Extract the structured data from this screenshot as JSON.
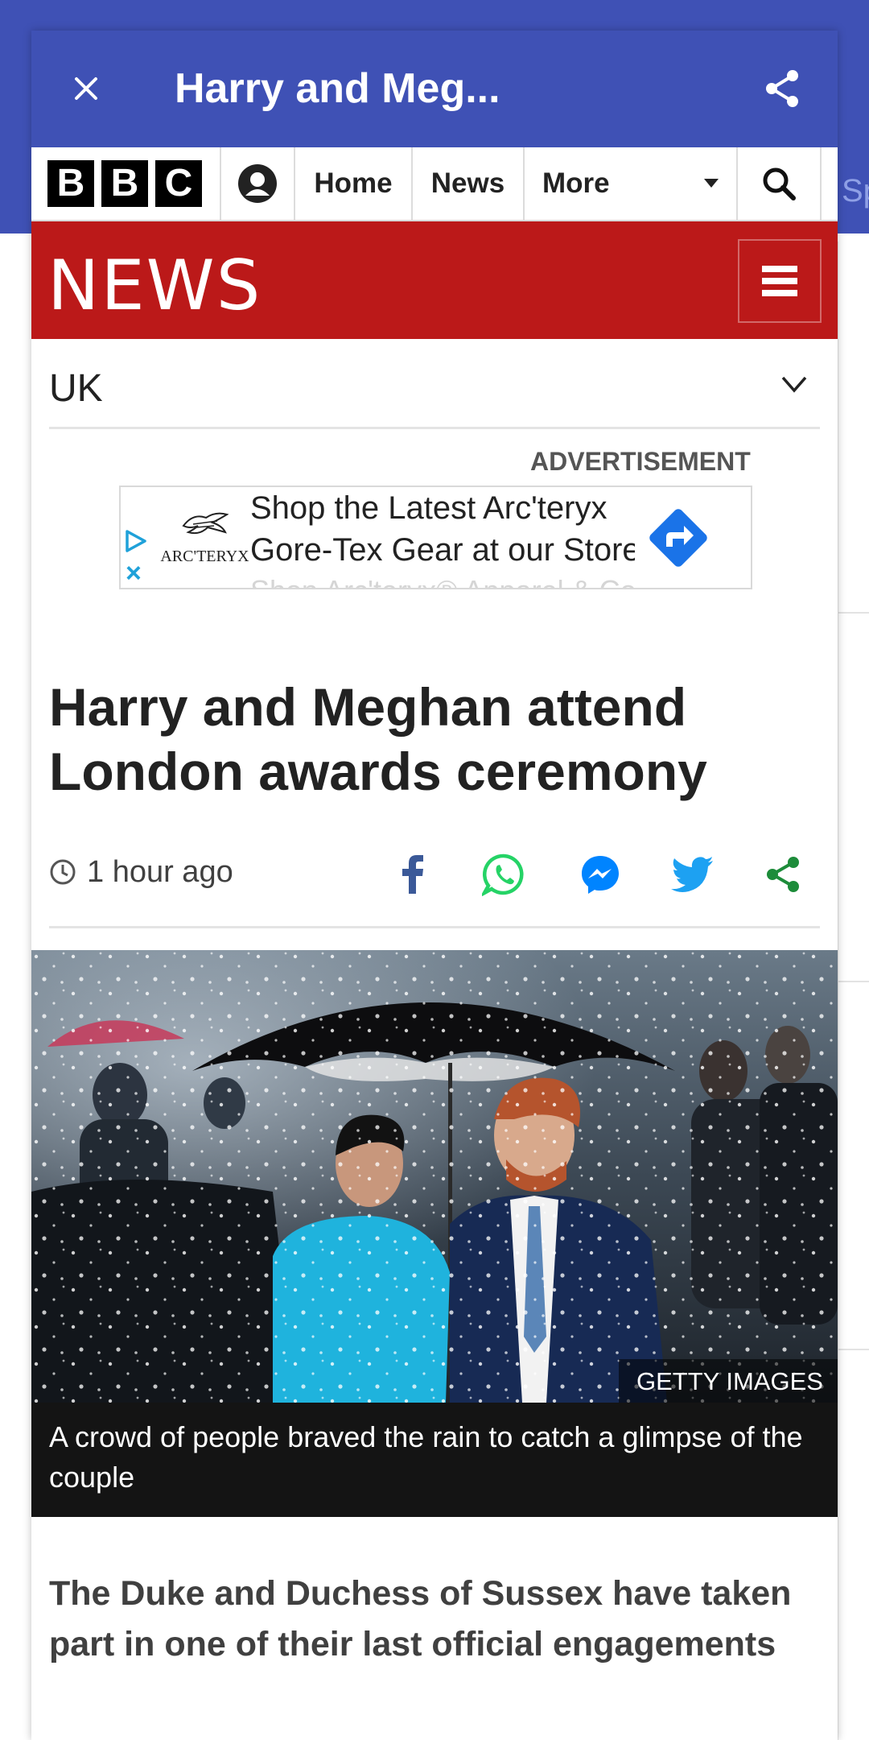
{
  "titlebar": {
    "title": "Harry and Meg...",
    "close_icon": "close-icon",
    "share_icon": "share-icon"
  },
  "bbc_nav": {
    "logo_letters": [
      "B",
      "B",
      "C"
    ],
    "account_icon": "account-icon",
    "home": "Home",
    "news": "News",
    "more": "More",
    "search_icon": "search-icon"
  },
  "news_band": {
    "wordmark": "NEWS",
    "menu_icon": "hamburger-menu-icon"
  },
  "section": {
    "label": "UK",
    "chevron_icon": "chevron-down-icon"
  },
  "ad": {
    "label": "ADVERTISEMENT",
    "brand": "ARC'TERYX",
    "line1": "Shop the Latest Arc'teryx",
    "line2": "Gore-Tex Gear at our Store",
    "line3": "Shop Arc'teryx® Apparel & Co",
    "close": "×"
  },
  "article": {
    "headline": "Harry and Meghan attend London awards ceremony",
    "time": "1 hour ago",
    "share_targets": [
      "facebook-icon",
      "whatsapp-icon",
      "messenger-icon",
      "twitter-icon",
      "share-icon"
    ],
    "image_credit": "GETTY IMAGES",
    "caption": "A crowd of people braved the rain to catch a glimpse of the couple",
    "intro": "The Duke and Duchess of Sussex have taken part in one of their last official engagements"
  },
  "background_app": {
    "side_text": "Sp"
  },
  "colors": {
    "app_bar": "#3f51b5",
    "bbc_news_red": "#bb1919",
    "facebook": "#3b5998",
    "whatsapp": "#25d366",
    "messenger": "#0084ff",
    "twitter": "#1da1f2",
    "share_green": "#1d8c3a"
  }
}
